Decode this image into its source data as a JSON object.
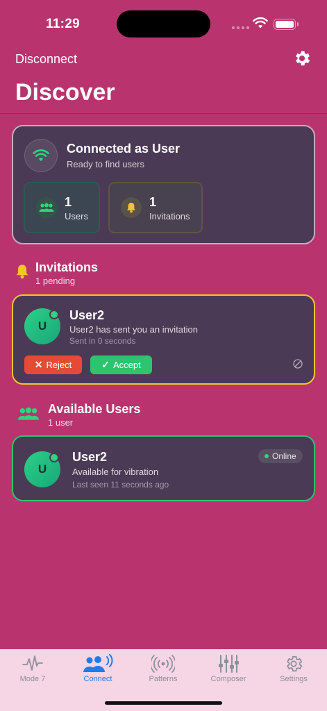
{
  "status_bar": {
    "time": "11:29"
  },
  "nav": {
    "left_label": "Disconnect",
    "title": "Discover"
  },
  "connection": {
    "title": "Connected as User",
    "subtitle": "Ready to find users",
    "stats": [
      {
        "value": "1",
        "label": "Users"
      },
      {
        "value": "1",
        "label": "Invitations"
      }
    ]
  },
  "invitations_section": {
    "title": "Invitations",
    "subtitle": "1 pending",
    "items": [
      {
        "avatar_initial": "U",
        "name": "User2",
        "message": "User2 has sent you an invitation",
        "time": "Sent in 0 seconds",
        "reject_label": "Reject",
        "accept_label": "Accept"
      }
    ]
  },
  "users_section": {
    "title": "Available Users",
    "subtitle": "1 user",
    "items": [
      {
        "avatar_initial": "U",
        "name": "User2",
        "status": "Available for vibration",
        "last_seen": "Last seen 11 seconds ago",
        "badge": "Online"
      }
    ]
  },
  "tabs": [
    {
      "label": "Mode 7",
      "icon": "waveform-icon"
    },
    {
      "label": "Connect",
      "icon": "people-wave-icon",
      "active": true
    },
    {
      "label": "Patterns",
      "icon": "vibration-icon"
    },
    {
      "label": "Composer",
      "icon": "sliders-icon"
    },
    {
      "label": "Settings",
      "icon": "gear-icon"
    }
  ],
  "colors": {
    "background": "#b9346f",
    "card": "#4b3a55",
    "accent_green": "#2dc470",
    "accent_yellow": "#f5c52a",
    "reject_red": "#e64a35",
    "active_tab": "#1f7cf0",
    "tab_bar": "#f6d5e5"
  }
}
